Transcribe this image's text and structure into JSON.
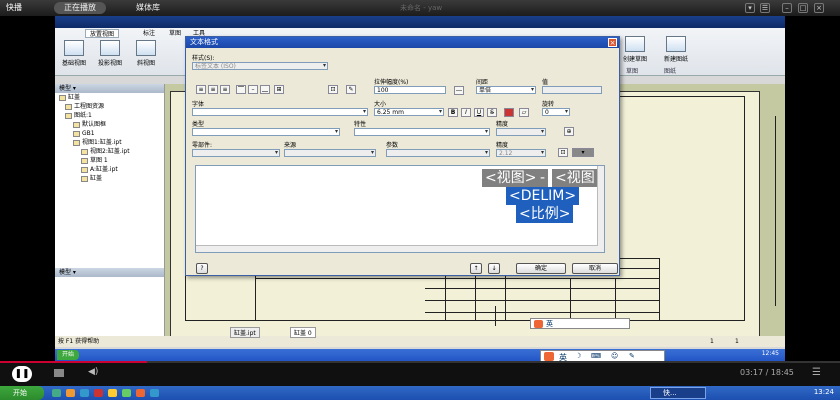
{
  "player": {
    "app_name": "快播",
    "tab_now_playing": "正在播放",
    "tab_media_library": "媒体库",
    "title": "未命名 - yaw",
    "time": "03:17 / 18:45"
  },
  "app": {
    "title": "",
    "ribbon_tabs": [
      "放置视图",
      "标注",
      "草图",
      "工具"
    ],
    "ribbon_buttons": [
      "基础视图",
      "投影视图",
      "斜视图"
    ],
    "right_ribbon_buttons": [
      "创建草图",
      "新建图纸"
    ],
    "right_ribbon_groups": [
      "草图",
      "图纸"
    ]
  },
  "browser": {
    "header": "模型 ▾",
    "items": [
      "缸盖",
      "工程图资源",
      "图纸:1",
      "默认图框",
      "GB1",
      "视图1:缸盖.ipt",
      "视图2:缸盖.ipt",
      "草图 1",
      "A:缸盖.ipt",
      "缸盖"
    ]
  },
  "model_panel": {
    "header": "模型 ▾"
  },
  "doc_tabs": [
    "缸盖.ipt",
    "缸盖 0"
  ],
  "status": {
    "help": "按 F1 获得帮助",
    "num1": "1",
    "num2": "1"
  },
  "inner_taskbar": {
    "start": "开始",
    "clock": "12:45"
  },
  "ime": {
    "label": "英"
  },
  "dialog": {
    "title": "文本格式",
    "close": "×",
    "style_label": "样式(S):",
    "style_value": "标签文本 (ISO)",
    "stretch_label": "拉伸幅度(%)",
    "stretch_value": "100",
    "spacing_label": "间距",
    "spacing_value": "单倍",
    "value_label": "值",
    "font_label": "字体",
    "size_label": "大小",
    "size_value": "6.25 mm",
    "rotate_label": "旋转",
    "rotate_value": "0",
    "bold": "B",
    "italic": "I",
    "underline": "U",
    "type_label": "类型",
    "property_label": "特性",
    "precision_label": "精度",
    "component_label": "零部件:",
    "source_label": "来源",
    "param_label": "参数",
    "precision2_label": "精度",
    "precision2_value": "2.12",
    "tokens": {
      "view": "<视图>",
      "dash": "-",
      "view2": "<视图",
      "delim": "<DELIM>",
      "scale": "<比例>"
    },
    "help": "?",
    "ok": "确定",
    "cancel": "取消"
  },
  "host_taskbar": {
    "start": "开始",
    "app_label": "快...",
    "clock": "13:24"
  },
  "colors": {
    "selection": "#1f5fbd",
    "title_bar": "#1a46a8",
    "progress": "#cc0033"
  },
  "progress": {
    "fraction": 0.175
  }
}
